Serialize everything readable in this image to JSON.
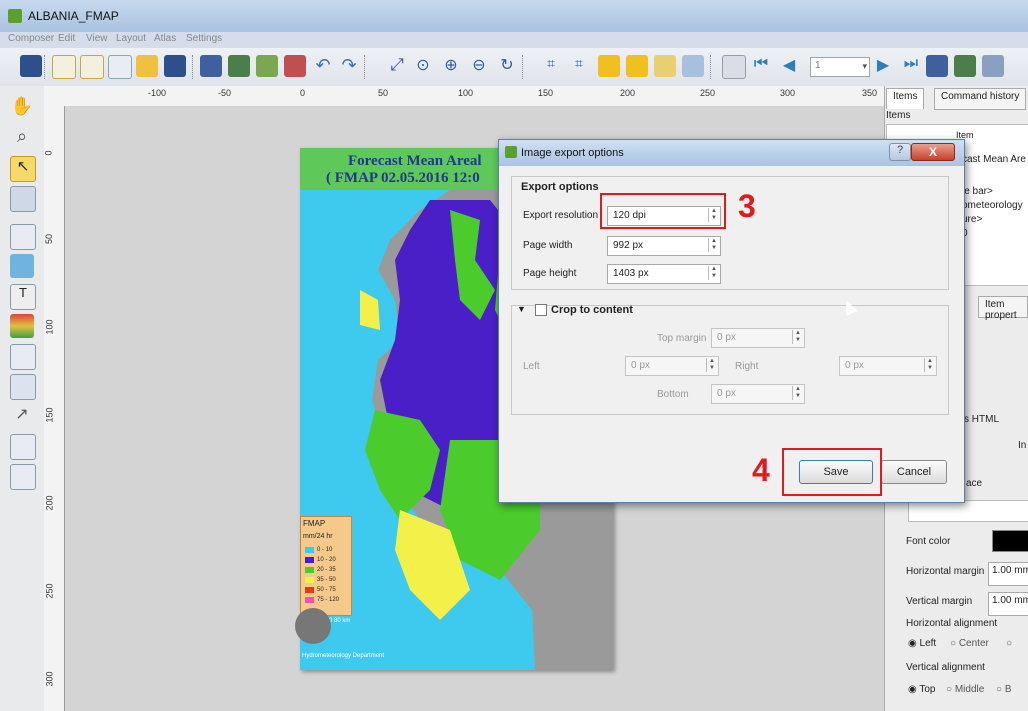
{
  "window": {
    "title": "ALBANIA_FMAP"
  },
  "menu": [
    "Composer",
    "Edit",
    "View",
    "Layout",
    "Atlas",
    "Settings"
  ],
  "toolbar": {
    "page_number": "1"
  },
  "ruler": {
    "h_ticks": [
      "-100",
      "-50",
      "0",
      "50",
      "100",
      "150",
      "200",
      "250",
      "300",
      "350"
    ],
    "v_ticks": [
      "0",
      "50",
      "100",
      "150",
      "200",
      "250",
      "300"
    ]
  },
  "map": {
    "title_line1": "Forecast Mean Areal",
    "title_line2": "( FMAP 02.05.2016 12:0",
    "legend_title": "FMAP",
    "legend_unit": "mm/24 hr",
    "legend_items": [
      {
        "label": "0 - 10",
        "color": "#3ec9ee"
      },
      {
        "label": "10 - 20",
        "color": "#4b1fc8"
      },
      {
        "label": "20 - 35",
        "color": "#4ccb2c"
      },
      {
        "label": "35 - 50",
        "color": "#f4f04a"
      },
      {
        "label": "50 - 75",
        "color": "#e23b1c"
      },
      {
        "label": "75 - 120",
        "color": "#ee52b8"
      }
    ],
    "scalebar_labels": "0    20    40    60    80 km",
    "footer": "Hydrometeorology Department"
  },
  "right_panel": {
    "tabs": [
      "Items",
      "Command history"
    ],
    "items_header": "Items",
    "item_col": "Item",
    "items": [
      "cast Mean Are",
      "le bar>",
      "ometeorology",
      "ure>",
      "0"
    ],
    "item_properties_tab": "Item propert",
    "html_label": "s HTML",
    "in_label": "In",
    "ace_label": "ace",
    "font_color_label": "Font color",
    "h_margin_label": "Horizontal margin",
    "h_margin_value": "1.00 mm",
    "v_margin_label": "Vertical margin",
    "v_margin_value": "1.00 mm",
    "h_align_label": "Horizontal alignment",
    "h_align_options": [
      "Left",
      "Center"
    ],
    "v_align_label": "Vertical alignment",
    "v_align_options": [
      "Top",
      "Middle",
      "B"
    ]
  },
  "dialog": {
    "title": "Image export options",
    "help": "?",
    "close": "X",
    "export_group": "Export options",
    "resolution_label": "Export resolution",
    "resolution_value": "120 dpi",
    "width_label": "Page width",
    "width_value": "992 px",
    "height_label": "Page height",
    "height_value": "1403 px",
    "crop_label": "Crop to content",
    "crop_checked": false,
    "top_margin_label": "Top margin",
    "top_margin_value": "0 px",
    "left_label": "Left",
    "left_value": "0 px",
    "right_label": "Right",
    "right_value": "0 px",
    "bottom_label": "Bottom",
    "bottom_value": "0 px",
    "save_label": "Save",
    "cancel_label": "Cancel"
  },
  "annotations": {
    "step3": "3",
    "step4": "4",
    "color": "#e01b1b"
  }
}
